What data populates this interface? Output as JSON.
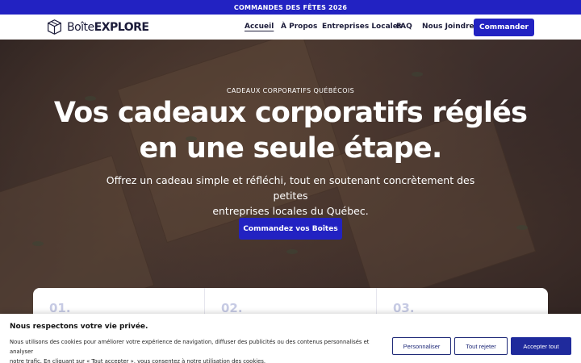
{
  "announcement": "COMMANDES DES FÊTES 2026",
  "header": {
    "logo": {
      "light": "Boîte",
      "bold": "EXPLORE"
    },
    "nav": [
      {
        "label": "Accueil",
        "active": true
      },
      {
        "label": "À Propos",
        "active": false
      },
      {
        "label": "Entreprises Locales",
        "active": false
      },
      {
        "label": "FAQ",
        "active": false
      },
      {
        "label": "Nous Joindre",
        "active": false
      }
    ],
    "cta": "Commander"
  },
  "hero": {
    "eyebrow": "CADEAUX CORPORATIFS QUÉBÉCOIS",
    "headline_line1": "Vos cadeaux corporatifs réglés",
    "headline_line2": "en une seule étape.",
    "subtitle_line1": "Offrez un cadeau simple et réfléchi, tout en soutenant concrètement des petites",
    "subtitle_line2": "entreprises locales du Québec.",
    "cta": "Commandez vos Boîtes"
  },
  "steps": [
    {
      "number": "01."
    },
    {
      "number": "02."
    },
    {
      "number": "03."
    }
  ],
  "cookie": {
    "title": "Nous respectons votre vie privée.",
    "text_line1": "Nous utilisons des cookies pour améliorer votre expérience de navigation, diffuser des publicités ou des contenus personnalisés et analyser",
    "text_line2": "notre trafic. En cliquant sur « Tout accepter », vous consentez à notre utilisation des cookies.",
    "customize": "Personnaliser",
    "reject": "Tout rejeter",
    "accept": "Accepter tout"
  },
  "colors": {
    "brand": "#2222c2",
    "cookie_button": "#1f2a9c",
    "step_number": "#c7cbe4"
  },
  "icons": {
    "logo": "box-icon"
  }
}
